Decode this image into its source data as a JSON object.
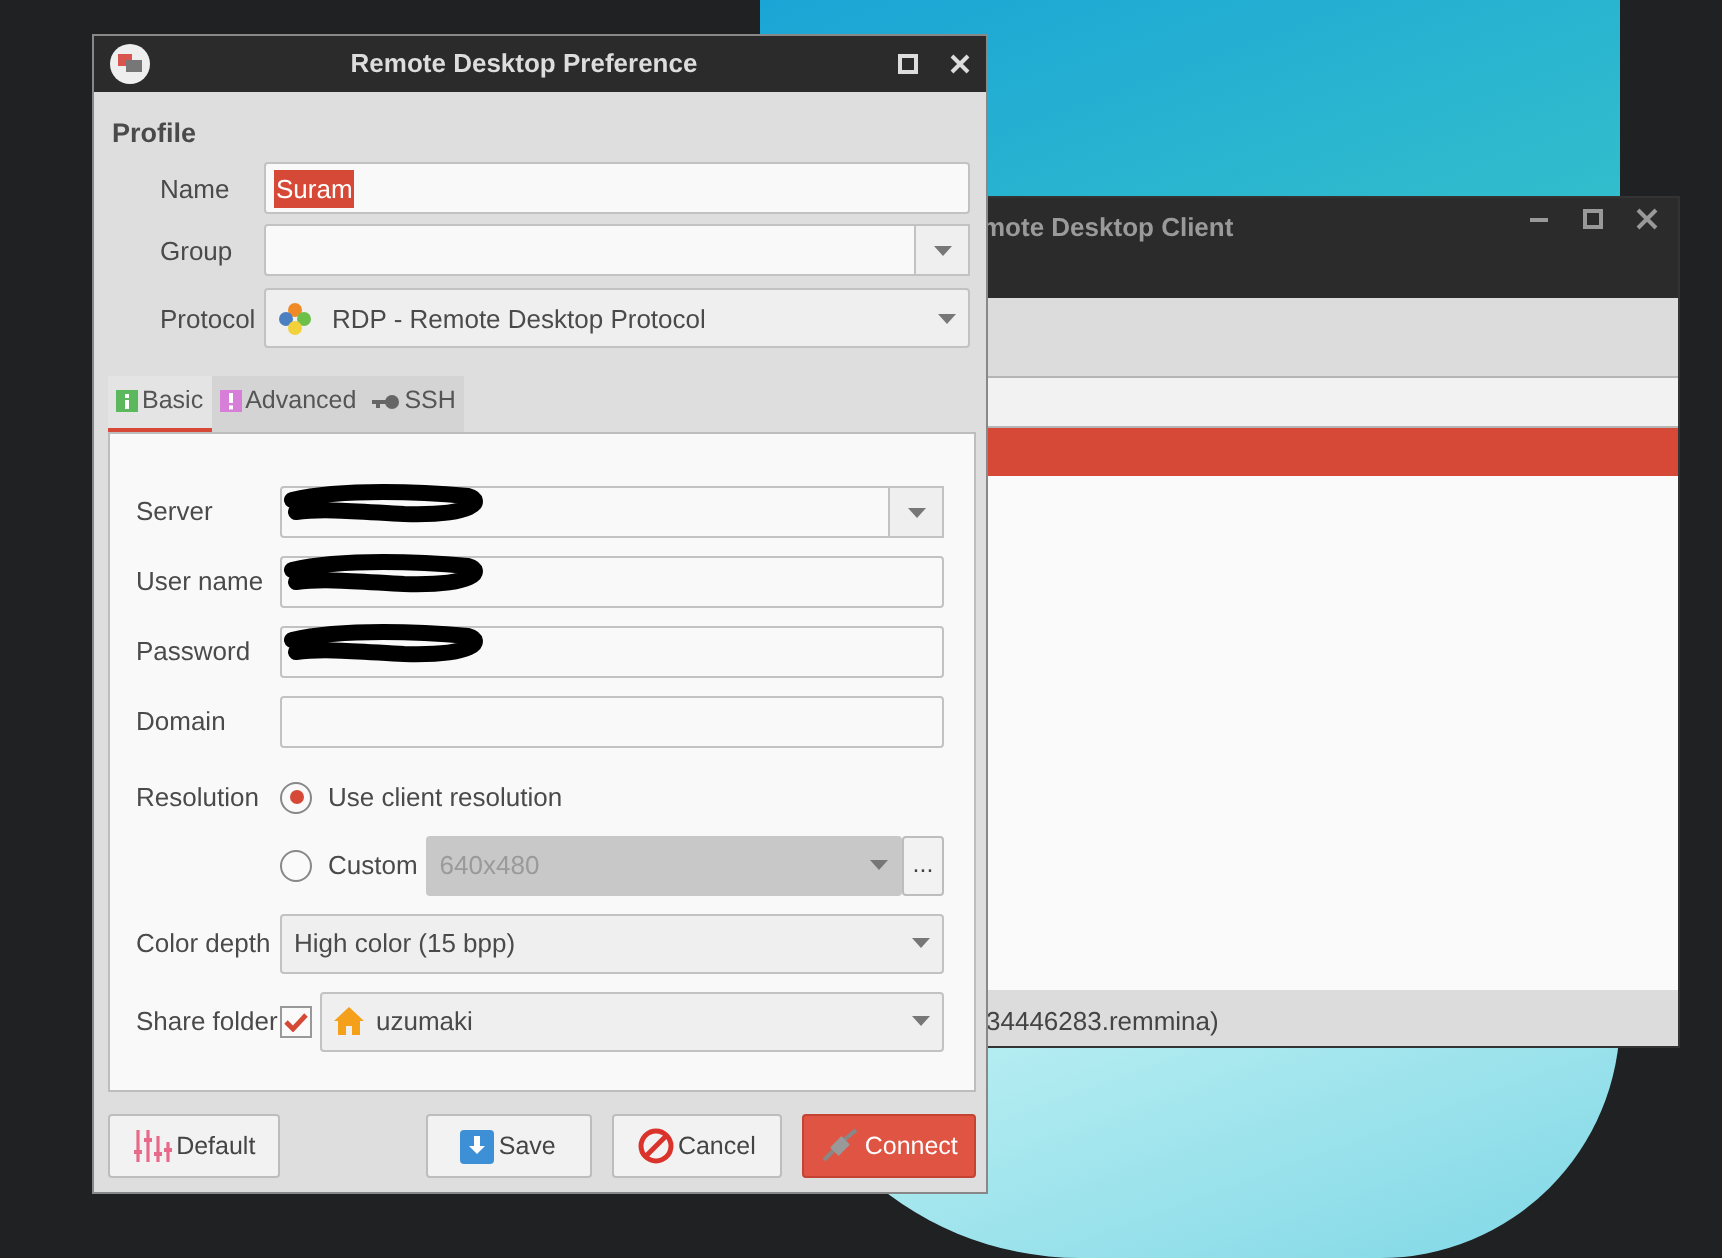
{
  "background_window": {
    "title": "mote Desktop Client",
    "status": "34446283.remmina)"
  },
  "dialog": {
    "title": "Remote Desktop Preference",
    "section": "Profile",
    "profile_fields": [
      {
        "kind": "text",
        "label": "Name",
        "value": "Suram",
        "text_selected": true
      },
      {
        "kind": "combo",
        "label": "Group"
      },
      {
        "kind": "select",
        "label": "Protocol",
        "value": "RDP - Remote Desktop Protocol"
      }
    ],
    "tabs": [
      {
        "kind": "info",
        "label": "Basic",
        "selected": true
      },
      {
        "kind": "warning",
        "label": "Advanced",
        "selected": false
      },
      {
        "kind": "key",
        "label": "SSH",
        "selected": false
      }
    ],
    "basic_fields": [
      {
        "kind": "combo",
        "label": "Server",
        "redacted": true
      },
      {
        "kind": "text",
        "label": "User name",
        "redacted": true
      },
      {
        "kind": "text",
        "label": "Password",
        "redacted": true
      },
      {
        "kind": "text",
        "label": "Domain",
        "redacted": false
      }
    ],
    "resolution": {
      "label": "Resolution",
      "options": [
        {
          "label": "Use client resolution",
          "selected": true
        },
        {
          "label": "Custom",
          "selected": false
        }
      ],
      "custom_value": "640x480",
      "custom_disabled": true,
      "more": "..."
    },
    "color_depth": {
      "label": "Color depth",
      "value": "High color (15 bpp)"
    },
    "share_folder": {
      "label": "Share folder",
      "checked": true,
      "value": "uzumaki"
    },
    "buttons": [
      {
        "kind": "default",
        "label": "Default"
      },
      {
        "kind": "save",
        "label": "Save"
      },
      {
        "kind": "cancel",
        "label": "Cancel"
      },
      {
        "kind": "connect",
        "label": "Connect"
      }
    ]
  }
}
